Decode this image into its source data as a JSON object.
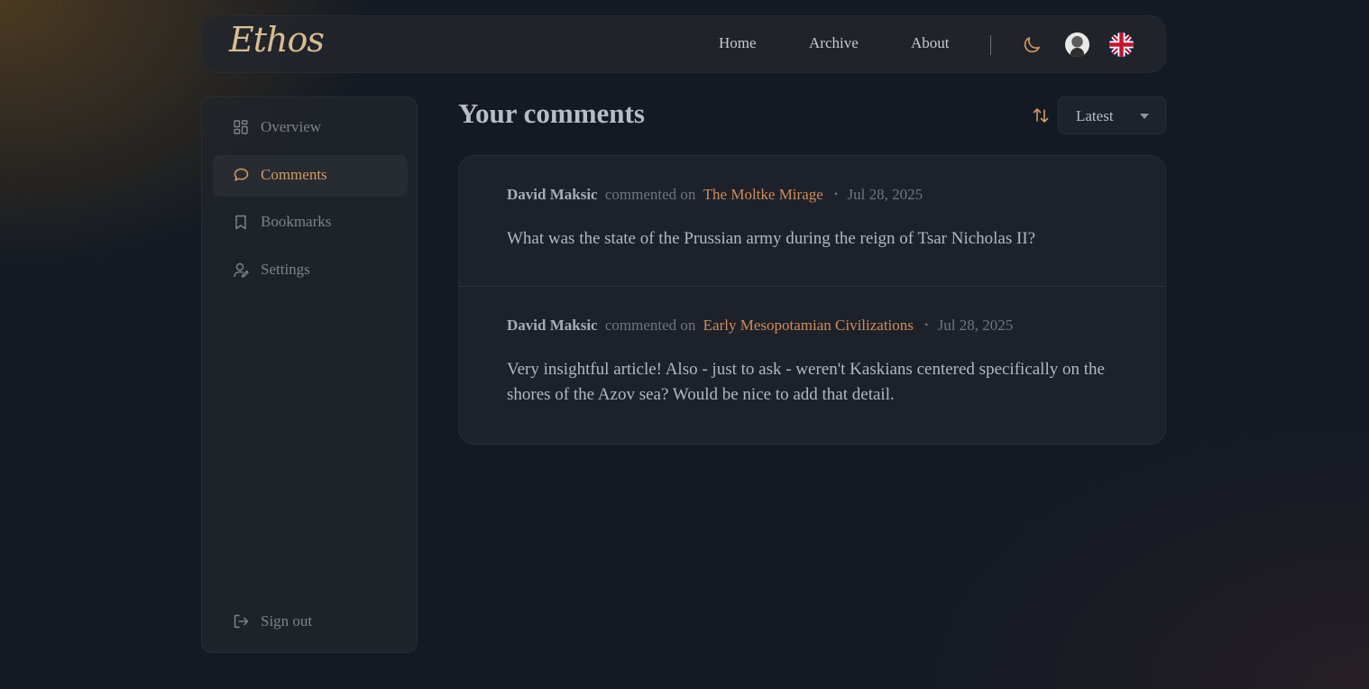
{
  "header": {
    "logo": "Ethos",
    "nav": {
      "home": "Home",
      "archive": "Archive",
      "about": "About"
    },
    "icons": [
      "moon-icon",
      "avatar",
      "uk-flag-icon"
    ]
  },
  "sidebar": {
    "items": [
      {
        "label": "Overview",
        "icon": "grid-icon"
      },
      {
        "label": "Comments",
        "icon": "chat-bubble-icon",
        "active": true
      },
      {
        "label": "Bookmarks",
        "icon": "bookmark-icon"
      },
      {
        "label": "Settings",
        "icon": "user-settings-icon"
      }
    ],
    "sign_out": "Sign out"
  },
  "main": {
    "title": "Your comments",
    "sort": {
      "selected": "Latest"
    },
    "comments": [
      {
        "author": "David Maksic",
        "verb": "commented on",
        "article": "The Moltke Mirage",
        "separator": "•",
        "date": "Jul 28, 2025",
        "text": "What was the state of the Prussian army during the reign of Tsar Nicholas II?"
      },
      {
        "author": "David Maksic",
        "verb": "commented on",
        "article": "Early Mesopotamian Civilizations",
        "separator": "•",
        "date": "Jul 28, 2025",
        "text": "Very insightful article! Also - just to ask - weren't Kaskians centered specifically on the shores of the Azov sea? Would be nice to add that detail."
      }
    ]
  },
  "colors": {
    "accent": "#d49a5e",
    "link": "#d08c56",
    "background": "#141a23"
  }
}
